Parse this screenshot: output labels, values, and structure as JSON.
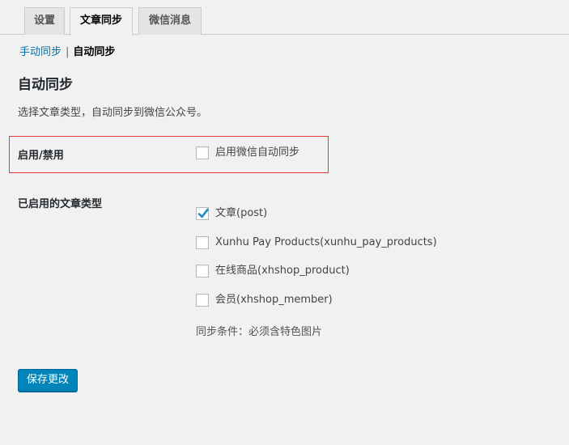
{
  "tabs": [
    {
      "label": "设置",
      "active": false
    },
    {
      "label": "文章同步",
      "active": true
    },
    {
      "label": "微信消息",
      "active": false
    }
  ],
  "subnav": {
    "manual_link": "手动同步",
    "separator": "|",
    "current": "自动同步"
  },
  "page": {
    "title": "自动同步",
    "description": "选择文章类型，自动同步到微信公众号。"
  },
  "enable_row": {
    "label": "启用/禁用",
    "checkbox_label": "启用微信自动同步",
    "checked": false
  },
  "post_types": {
    "label": "已启用的文章类型",
    "items": [
      {
        "label": "文章(post)",
        "checked": true
      },
      {
        "label": "Xunhu Pay Products(xunhu_pay_products)",
        "checked": false
      },
      {
        "label": "在线商品(xhshop_product)",
        "checked": false
      },
      {
        "label": "会员(xhshop_member)",
        "checked": false
      }
    ],
    "note": "同步条件：必须含特色图片"
  },
  "save_button": "保存更改",
  "colors": {
    "accent": "#0085ba",
    "link": "#0073aa",
    "highlight_border": "#e03a3a",
    "check": "#1e8cbe"
  }
}
